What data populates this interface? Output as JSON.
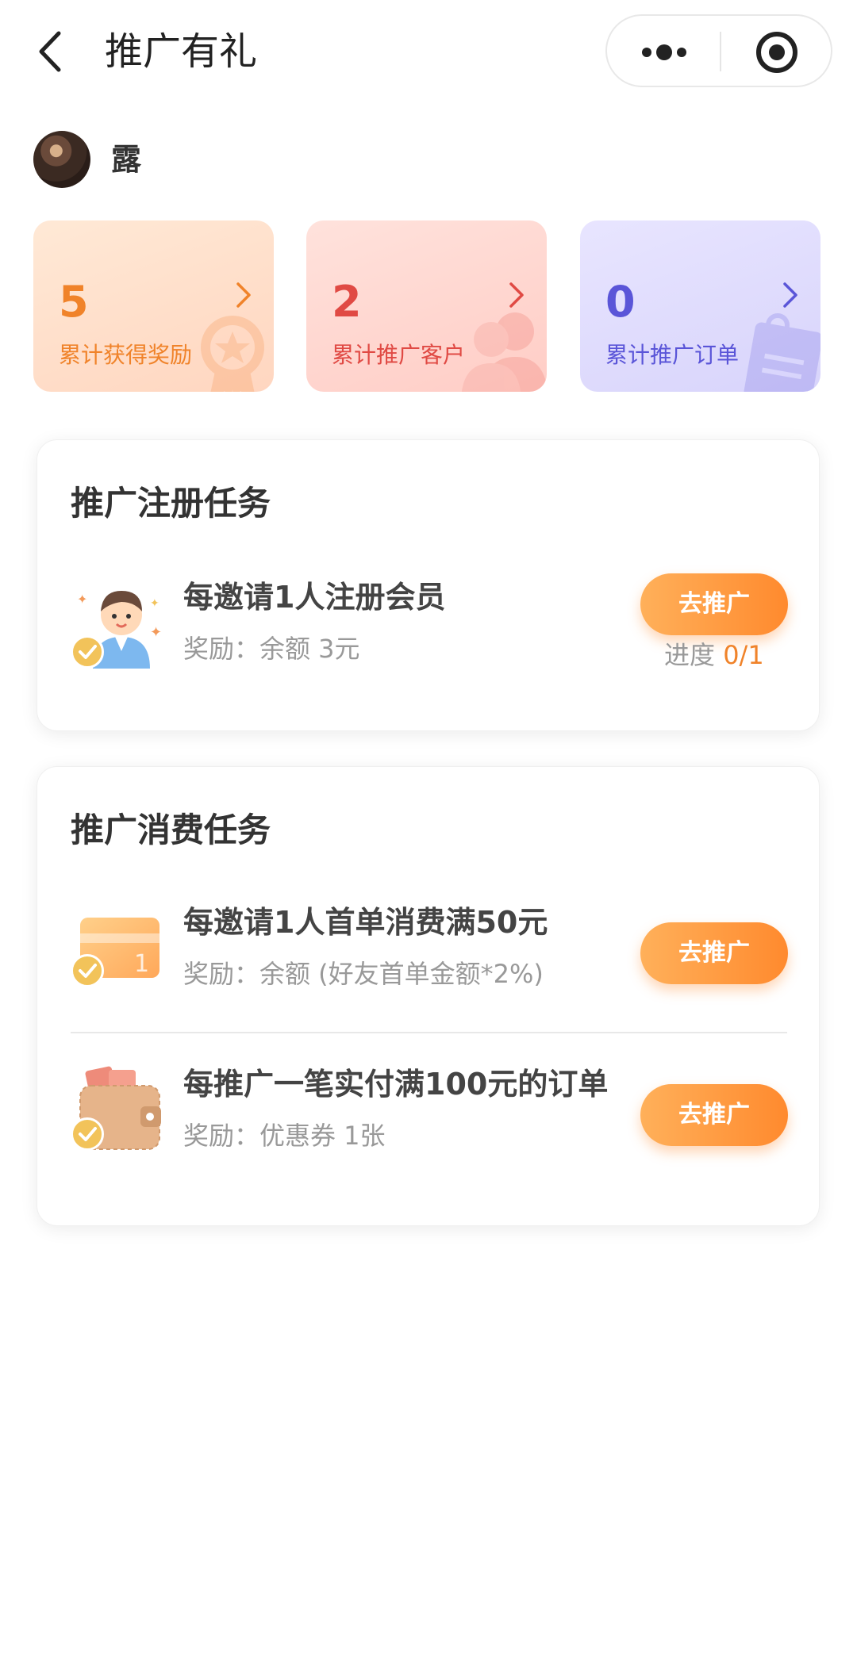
{
  "nav": {
    "title": "推广有礼"
  },
  "user": {
    "name": "露"
  },
  "stats": [
    {
      "value": "5",
      "label": "累计获得奖励"
    },
    {
      "value": "2",
      "label": "累计推广客户"
    },
    {
      "value": "0",
      "label": "累计推广订单"
    }
  ],
  "register_tasks": {
    "title": "推广注册任务",
    "items": [
      {
        "name": "每邀请1人注册会员",
        "reward": "奖励：余额 3元",
        "button": "去推广",
        "progress_label": "进度 ",
        "progress_value": "0/1"
      }
    ]
  },
  "consume_tasks": {
    "title": "推广消费任务",
    "items": [
      {
        "name": "每邀请1人首单消费满50元",
        "reward": "奖励：余额 (好友首单金额*2%)",
        "button": "去推广"
      },
      {
        "name": "每推广一笔实付满100元的订单",
        "reward": "奖励：优惠券 1张",
        "button": "去推广"
      }
    ]
  },
  "icons": {
    "back": "chevron-left-icon",
    "more": "more-dots-icon",
    "target": "target-icon",
    "stat_arrow": "chevron-right-icon",
    "task1": "user-avatar-icon",
    "task2": "card-icon",
    "task3": "wallet-icon",
    "check": "check-badge-icon"
  },
  "colors": {
    "accent_orange": "#f0832a",
    "accent_red": "#e04a44",
    "accent_purple": "#5a55d8",
    "button_gradient_start": "#ffb05a",
    "button_gradient_end": "#ff8a2e"
  }
}
